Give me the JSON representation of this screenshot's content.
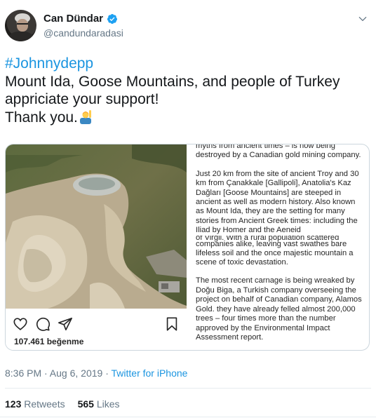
{
  "author": {
    "display_name": "Can Dündar",
    "handle": "@candundaradasi",
    "verified": true
  },
  "tweet": {
    "hashtag": "#Johnnydepp",
    "line2": "Mount Ida, Goose Mountains, and people of Turkey",
    "line3": "appriciate your support!",
    "line4": "Thank you.",
    "emoji": "person-raising-hand"
  },
  "media": {
    "likes": "107.461 beğenme",
    "article_top": "myths from ancient times – is now being destroyed by a Canadian gold mining company.",
    "article_p2": "Just 20 km from the site of ancient Troy and 30 km from Çanakkale [Gallipoli], Anatolia's Kaz Dağları [Goose Mountains] are steeped in ancient as well as modern history. Also known as Mount Ida, they are the setting for many stories from Ancient Greek times: including the Iliad by Homer and the Aeneid",
    "article_overlap_a": "of Virgil. With a rural population scattered",
    "article_overlap_b": "companies alike, leaving vast swathes bare",
    "article_p3": "lifeless soil and the once majestic mountain a scene of toxic devastation.",
    "article_p4": "The most recent carnage is being wreaked by Doğu Biga, a Turkish company overseeing the project on behalf of Canadian company, Alamos Gold. they have already felled almost 200,000 trees – four times more than the number approved by the Environmental Impact Assessment report."
  },
  "meta": {
    "timestamp": "8:36 PM · Aug 6, 2019 · ",
    "source": "Twitter for iPhone"
  },
  "stats": {
    "retweets_count": "123",
    "retweets_label": "Retweets",
    "likes_count": "565",
    "likes_label": "Likes"
  },
  "colors": {
    "link": "#1b95e0",
    "secondary": "#657786",
    "verified": "#1da1f2"
  }
}
